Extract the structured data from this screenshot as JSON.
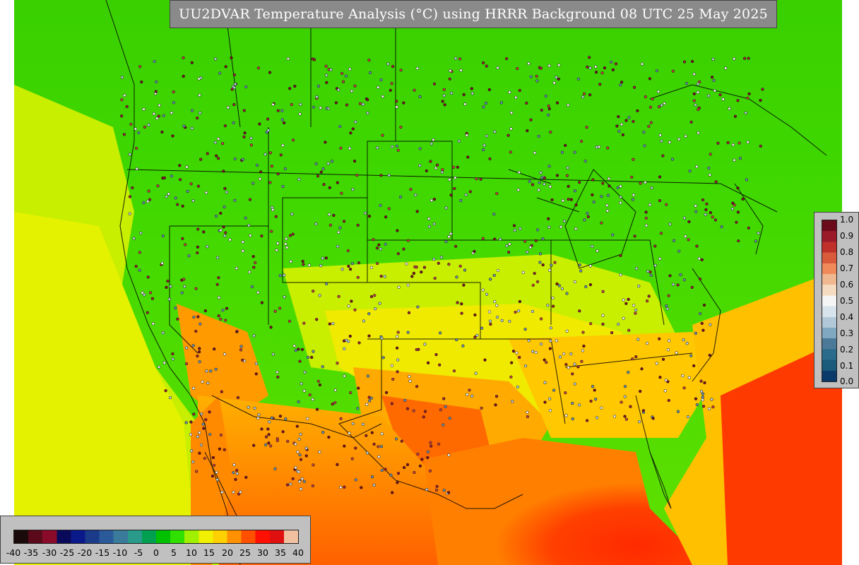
{
  "title": "UU2DVAR Temperature Analysis (°C) using HRRR Background 08 UTC 25 May 2025",
  "temperature_legend": {
    "ticks": [
      "-40",
      "-35",
      "-30",
      "-25",
      "-20",
      "-15",
      "-10",
      "-5",
      "0",
      "5",
      "10",
      "15",
      "20",
      "25",
      "30",
      "35",
      "40"
    ],
    "colors": [
      "#1a0a0a",
      "#5a0a1a",
      "#8a0a2a",
      "#0a0a5a",
      "#0a1a8a",
      "#1a3a8a",
      "#2a5a9a",
      "#3a7a9a",
      "#2a9a8a",
      "#00a050",
      "#00c000",
      "#30e000",
      "#a0f000",
      "#f0f000",
      "#ffd000",
      "#ff9000",
      "#ff5000",
      "#ff1000",
      "#e01010",
      "#f0c0a0"
    ]
  },
  "probability_legend": {
    "ticks": [
      "1.0",
      "0.9",
      "0.8",
      "0.7",
      "0.6",
      "0.5",
      "0.4",
      "0.3",
      "0.2",
      "0.1",
      "0.0"
    ],
    "colors": [
      "#6a0a1a",
      "#9a1a2a",
      "#c0302a",
      "#d85a3a",
      "#f08a5a",
      "#f0b890",
      "#f5dcc0",
      "#f5f5f5",
      "#d8e4ec",
      "#b0c8d8",
      "#80a8c0",
      "#4a7a98",
      "#2a6a8a",
      "#1a5a7a",
      "#0a3a6a"
    ]
  }
}
